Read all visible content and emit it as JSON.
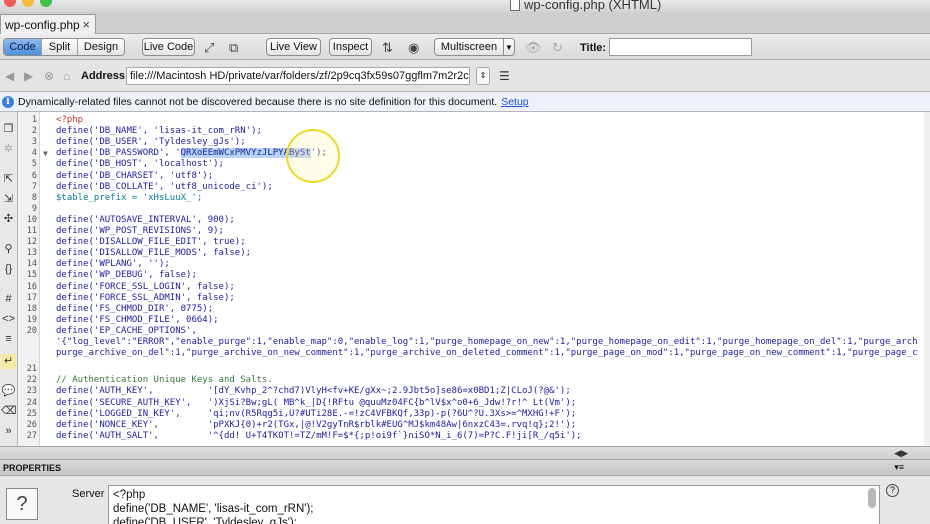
{
  "window": {
    "title": "wp-config.php (XHTML)"
  },
  "tab": {
    "label": "wp-config.php",
    "close": "×"
  },
  "toolbar": {
    "view_code": "Code",
    "view_split": "Split",
    "view_design": "Design",
    "live_code": "Live Code",
    "live_view": "Live View",
    "inspect": "Inspect",
    "multiscreen": "Multiscreen",
    "title_label": "Title:",
    "title_value": ""
  },
  "address": {
    "label": "Address:",
    "value": "file:///Macintosh HD/private/var/folders/zf/2p9cq3fx59s07ggflm7m2r2c00"
  },
  "info": {
    "message": "Dynamically-related files cannot not be discovered because there is no site definition for this document.",
    "link": "Setup"
  },
  "code_lines": [
    {
      "n": "1",
      "text": "<?php"
    },
    {
      "n": "2",
      "text": "define('DB_NAME', 'lisas-it_com_rRN');"
    },
    {
      "n": "3",
      "text": "define('DB_USER', 'Tyldesley_gJs');"
    },
    {
      "n": "4",
      "pre": "define('DB_PASSWORD', '",
      "sel": "QRXoEEmWCxPMVYzJLPYABySt",
      "post": "');"
    },
    {
      "n": "5",
      "text": "define('DB_HOST', 'localhost');"
    },
    {
      "n": "6",
      "text": "define('DB_CHARSET', 'utf8');"
    },
    {
      "n": "7",
      "text": "define('DB_COLLATE', 'utf8_unicode_ci');"
    },
    {
      "n": "8",
      "text": "$table_prefix = 'xHsLuuX_';"
    },
    {
      "n": "9",
      "text": ""
    },
    {
      "n": "10",
      "text": "define('AUTOSAVE_INTERVAL', 900);"
    },
    {
      "n": "11",
      "text": "define('WP_POST_REVISIONS', 9);"
    },
    {
      "n": "12",
      "text": "define('DISALLOW_FILE_EDIT', true);"
    },
    {
      "n": "13",
      "text": "define('DISALLOW_FILE_MODS', false);"
    },
    {
      "n": "14",
      "text": "define('WPLANG', '');"
    },
    {
      "n": "15",
      "text": "define('WP_DEBUG', false);"
    },
    {
      "n": "16",
      "text": "define('FORCE_SSL_LOGIN', false);"
    },
    {
      "n": "17",
      "text": "define('FORCE_SSL_ADMIN', false);"
    },
    {
      "n": "18",
      "text": "define('FS_CHMOD_DIR', 0775);"
    },
    {
      "n": "19",
      "text": "define('FS_CHMOD_FILE', 0664);"
    },
    {
      "n": "20",
      "text": "define('EP_CACHE_OPTIONS',"
    },
    {
      "n": "",
      "text": "'{\"log_level\":\"ERROR\",\"enable_purge\":1,\"enable_map\":0,\"enable_log\":1,\"purge_homepage_on_new\":1,\"purge_homepage_on_edit\":1,\"purge_homepage_on_del\":1,\"purge_arch"
    },
    {
      "n": "",
      "text": "purge_archive_on_del\":1,\"purge_archive_on_new_comment\":1,\"purge_archive_on_deleted_comment\":1,\"purge_page_on_mod\":1,\"purge_page_on_new_comment\":1,\"purge_page_c"
    },
    {
      "n": "21",
      "text": ""
    },
    {
      "n": "22",
      "text": "// Authentication Unique Keys and Salts."
    },
    {
      "n": "23",
      "text": "define('AUTH_KEY',          '[dY_Kvhp_2^?chd7)VlyH<fv+KE/gXx~;2.9Jbt5o]se86=x0BD1;Z|CLoJ(?@&');"
    },
    {
      "n": "24",
      "text": "define('SECURE_AUTH_KEY',   ')XjSi?Bw;gL( MB^k_|D{!RFtu @quuMz04FC{b^lV$x^o0+6_Jdw!?r!^ Lt(Vm');"
    },
    {
      "n": "25",
      "text": "define('LOGGED_IN_KEY',     'qi;nv(R5Rqg5i,U?#UTi28E.-=!zC4VFBKQf,33p)-p(?6U^?U.3Xs>=^MXHG!+F');"
    },
    {
      "n": "26",
      "text": "define('NONCE_KEY',         'pPXKJ{0)+r2(TGx,|@!V2gyTnR$rblk#EUG^MJ$km48Aw|6nxzC43=.rvq!q};2!');"
    },
    {
      "n": "27",
      "text": "define('AUTH_SALT',         '^{dd! U+T4TKOT!=TZ/mM!F=$*{;p!oi9f`}niSO*N_i_6(7)=P?C.F!ji[R_/q5i');"
    }
  ],
  "properties": {
    "header": "PROPERTIES",
    "server_label": "Server",
    "server_text": "<?php\ndefine('DB_NAME', 'lisas-it_com_rRN');\ndefine('DB_USER', 'Tyldesley_gJs');",
    "qmark": "?",
    "help": "?"
  }
}
